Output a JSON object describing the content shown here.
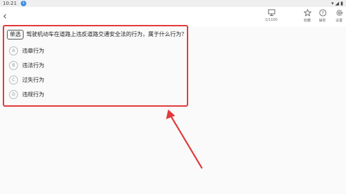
{
  "status": {
    "time": "10:21",
    "download_glyph": "⇩",
    "system_icons": "▾ ◢ ▮"
  },
  "toolbar": {
    "back_glyph": "‹",
    "counter_label": "1/1100",
    "favorite_label": "收藏",
    "explain_label": "解析",
    "settings_label": "设置"
  },
  "question": {
    "type": "单选",
    "text": "驾驶机动车在道路上违反道路交通安全法的行为，属于什么行为？",
    "options": [
      {
        "letter": "A",
        "text": "违章行为"
      },
      {
        "letter": "B",
        "text": "违法行为"
      },
      {
        "letter": "C",
        "text": "过失行为"
      },
      {
        "letter": "D",
        "text": "违规行为"
      }
    ]
  },
  "annotation_color": "#e23a3a"
}
